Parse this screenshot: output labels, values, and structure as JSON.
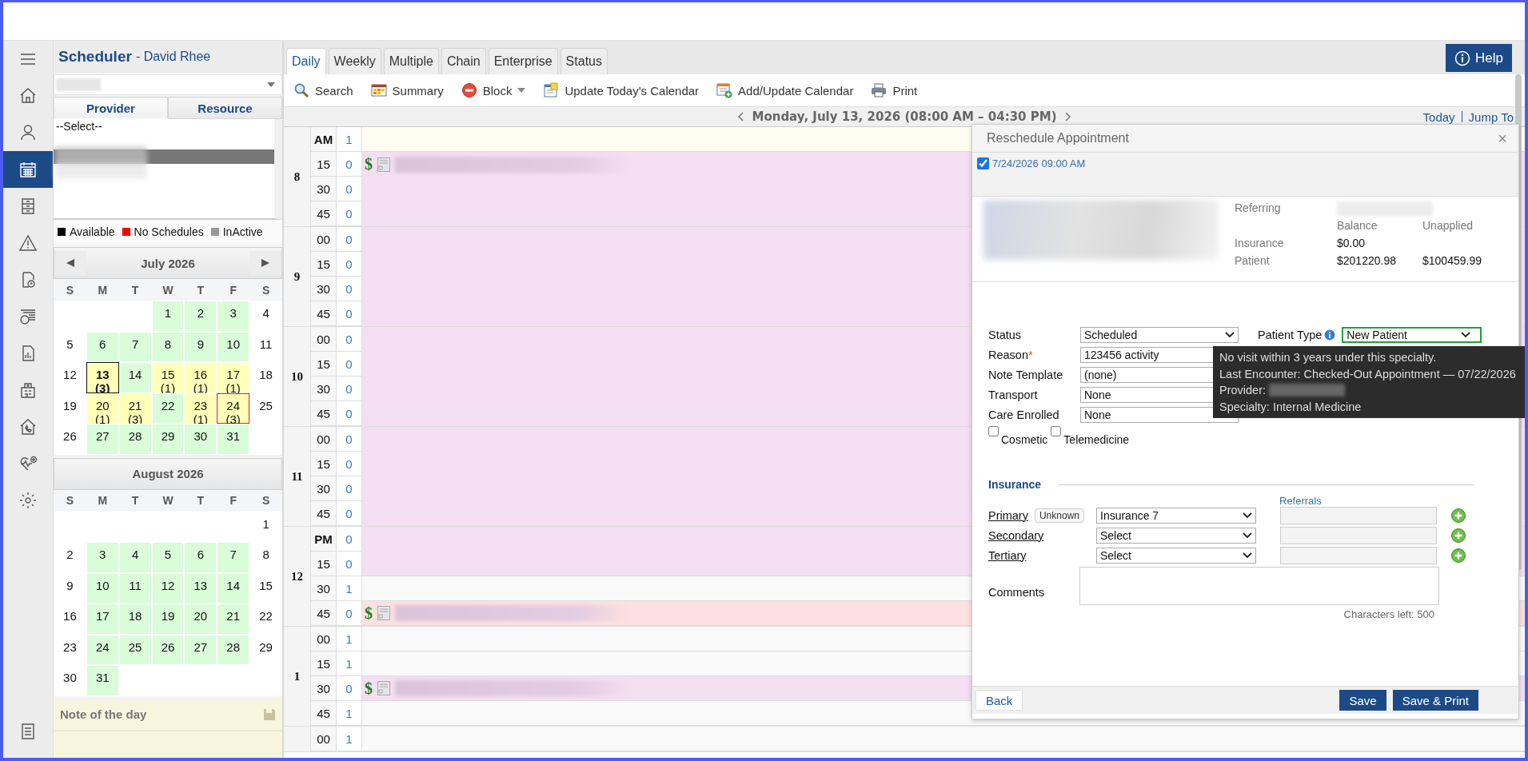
{
  "nav_rail": [
    {
      "selected": false
    },
    {
      "selected": false
    },
    {
      "selected": false
    },
    {
      "selected": true
    },
    {
      "selected": false
    },
    {
      "selected": false
    },
    {
      "selected": false
    },
    {
      "selected": false
    },
    {
      "selected": false
    },
    {
      "selected": false
    },
    {
      "selected": false
    },
    {
      "selected": false
    },
    {
      "selected": false
    }
  ],
  "nav_bottom": {
    "selected": false
  },
  "app_title": {
    "title": "Scheduler",
    "subtitle": "- David Rhee"
  },
  "selector_tabs": [
    {
      "label": "Provider",
      "selected": true
    },
    {
      "label": "Resource",
      "selected": false
    }
  ],
  "provider_list": [
    {
      "label": "--Select--",
      "selected": false
    },
    {
      "selected": true
    }
  ],
  "legend": [
    {
      "label": "Available",
      "color": "#000000"
    },
    {
      "label": "No Schedules",
      "color": "#ff0000"
    },
    {
      "label": "InActive",
      "color": "#999999"
    }
  ],
  "calendars": [
    {
      "title": "July 2026",
      "navigation": true,
      "weekdays": [
        "S",
        "M",
        "T",
        "W",
        "T",
        "F",
        "S"
      ],
      "days": [
        {
          "kind": "blank"
        },
        {
          "kind": "blank"
        },
        {
          "kind": "blank"
        },
        {
          "day": "1",
          "kind": "available",
          "today": false,
          "selected": false
        },
        {
          "day": "2",
          "kind": "available",
          "today": false,
          "selected": false
        },
        {
          "day": "3",
          "kind": "available",
          "today": false,
          "selected": false
        },
        {
          "day": "4",
          "kind": "open",
          "today": false,
          "selected": false
        },
        {
          "day": "5",
          "kind": "open",
          "today": false,
          "selected": false
        },
        {
          "day": "6",
          "kind": "available",
          "today": false,
          "selected": false
        },
        {
          "day": "7",
          "kind": "available",
          "today": false,
          "selected": false
        },
        {
          "day": "8",
          "kind": "available",
          "today": false,
          "selected": false
        },
        {
          "day": "9",
          "kind": "available",
          "today": false,
          "selected": false
        },
        {
          "day": "10",
          "kind": "available",
          "today": false,
          "selected": false
        },
        {
          "day": "11",
          "kind": "open",
          "today": false,
          "selected": false
        },
        {
          "day": "12",
          "kind": "open",
          "today": false,
          "selected": false
        },
        {
          "day": "13",
          "count": "(3)",
          "kind": "booked",
          "today": true,
          "selected": false
        },
        {
          "day": "14",
          "kind": "available",
          "today": false,
          "selected": false
        },
        {
          "day": "15",
          "count": "(1)",
          "kind": "booked",
          "today": false,
          "selected": false
        },
        {
          "day": "16",
          "count": "(1)",
          "kind": "booked",
          "today": false,
          "selected": false
        },
        {
          "day": "17",
          "count": "(1)",
          "kind": "booked",
          "today": false,
          "selected": false
        },
        {
          "day": "18",
          "kind": "open",
          "today": false,
          "selected": false
        },
        {
          "day": "19",
          "kind": "open",
          "today": false,
          "selected": false
        },
        {
          "day": "20",
          "count": "(1)",
          "kind": "booked",
          "today": false,
          "selected": false
        },
        {
          "day": "21",
          "count": "(3)",
          "kind": "booked",
          "today": false,
          "selected": false
        },
        {
          "day": "22",
          "kind": "available",
          "today": false,
          "selected": false
        },
        {
          "day": "23",
          "count": "(1)",
          "kind": "booked",
          "today": false,
          "selected": false
        },
        {
          "day": "24",
          "count": "(3)",
          "kind": "booked",
          "today": false,
          "selected": true
        },
        {
          "day": "25",
          "kind": "open",
          "today": false,
          "selected": false
        },
        {
          "day": "26",
          "kind": "open",
          "today": false,
          "selected": false
        },
        {
          "day": "27",
          "kind": "available",
          "today": false,
          "selected": false
        },
        {
          "day": "28",
          "kind": "available",
          "today": false,
          "selected": false
        },
        {
          "day": "29",
          "kind": "available",
          "today": false,
          "selected": false
        },
        {
          "day": "30",
          "kind": "available",
          "today": false,
          "selected": false
        },
        {
          "day": "31",
          "kind": "available",
          "today": false,
          "selected": false
        }
      ]
    },
    {
      "title": "August 2026",
      "navigation": false,
      "weekdays": [
        "S",
        "M",
        "T",
        "W",
        "T",
        "F",
        "S"
      ],
      "days": [
        {
          "kind": "blank"
        },
        {
          "kind": "blank"
        },
        {
          "kind": "blank"
        },
        {
          "kind": "blank"
        },
        {
          "kind": "blank"
        },
        {
          "kind": "blank"
        },
        {
          "day": "1",
          "kind": "open",
          "today": false,
          "selected": false
        },
        {
          "day": "2",
          "kind": "open",
          "today": false,
          "selected": false
        },
        {
          "day": "3",
          "kind": "available",
          "today": false,
          "selected": false
        },
        {
          "day": "4",
          "kind": "available",
          "today": false,
          "selected": false
        },
        {
          "day": "5",
          "kind": "available",
          "today": false,
          "selected": false
        },
        {
          "day": "6",
          "kind": "available",
          "today": false,
          "selected": false
        },
        {
          "day": "7",
          "kind": "available",
          "today": false,
          "selected": false
        },
        {
          "day": "8",
          "kind": "open",
          "today": false,
          "selected": false
        },
        {
          "day": "9",
          "kind": "open",
          "today": false,
          "selected": false
        },
        {
          "day": "10",
          "kind": "available",
          "today": false,
          "selected": false
        },
        {
          "day": "11",
          "kind": "available",
          "today": false,
          "selected": false
        },
        {
          "day": "12",
          "kind": "available",
          "today": false,
          "selected": false
        },
        {
          "day": "13",
          "kind": "available",
          "today": false,
          "selected": false
        },
        {
          "day": "14",
          "kind": "available",
          "today": false,
          "selected": false
        },
        {
          "day": "15",
          "kind": "open",
          "today": false,
          "selected": false
        },
        {
          "day": "16",
          "kind": "open",
          "today": false,
          "selected": false
        },
        {
          "day": "17",
          "kind": "available",
          "today": false,
          "selected": false
        },
        {
          "day": "18",
          "kind": "available",
          "today": false,
          "selected": false
        },
        {
          "day": "19",
          "kind": "available",
          "today": false,
          "selected": false
        },
        {
          "day": "20",
          "kind": "available",
          "today": false,
          "selected": false
        },
        {
          "day": "21",
          "kind": "available",
          "today": false,
          "selected": false
        },
        {
          "day": "22",
          "kind": "open",
          "today": false,
          "selected": false
        },
        {
          "day": "23",
          "kind": "open",
          "today": false,
          "selected": false
        },
        {
          "day": "24",
          "kind": "available",
          "today": false,
          "selected": false
        },
        {
          "day": "25",
          "kind": "available",
          "today": false,
          "selected": false
        },
        {
          "day": "26",
          "kind": "available",
          "today": false,
          "selected": false
        },
        {
          "day": "27",
          "kind": "available",
          "today": false,
          "selected": false
        },
        {
          "day": "28",
          "kind": "available",
          "today": false,
          "selected": false
        },
        {
          "day": "29",
          "kind": "open",
          "today": false,
          "selected": false
        },
        {
          "day": "30",
          "kind": "open",
          "today": false,
          "selected": false
        },
        {
          "day": "31",
          "kind": "available",
          "today": false,
          "selected": false
        }
      ]
    }
  ],
  "note_of_the_day": {
    "title": "Note of the day"
  },
  "view_tabs": [
    {
      "label": "Daily",
      "selected": true
    },
    {
      "label": "Weekly",
      "selected": false
    },
    {
      "label": "Multiple",
      "selected": false
    },
    {
      "label": "Chain",
      "selected": false
    },
    {
      "label": "Enterprise",
      "selected": false
    },
    {
      "label": "Status",
      "selected": false
    }
  ],
  "toolbar": [
    {
      "label": "Search",
      "dropdown": false
    },
    {
      "label": "Summary",
      "dropdown": false
    },
    {
      "label": "Block",
      "dropdown": true
    },
    {
      "label": "Update Today's Calendar",
      "dropdown": false
    },
    {
      "label": "Add/Update Calendar",
      "dropdown": false
    },
    {
      "label": "Print",
      "dropdown": false
    }
  ],
  "date_bar": {
    "date": "Monday, July 13, 2026 (08:00 AM – 04:30 PM)",
    "links": [
      "Today",
      "Jump To"
    ]
  },
  "help": {
    "label": "Help"
  },
  "schedule": [
    {
      "label": "8",
      "slots": [
        {
          "minute": "AM",
          "meridiem": true,
          "count": "1",
          "kind": "first"
        },
        {
          "minute": "15",
          "meridiem": false,
          "count": "0",
          "kind": "booked",
          "appointment": {
            "mark": "$"
          }
        },
        {
          "minute": "30",
          "meridiem": false,
          "count": "0",
          "kind": "booked"
        },
        {
          "minute": "45",
          "meridiem": false,
          "count": "0",
          "kind": "booked"
        }
      ]
    },
    {
      "label": "9",
      "slots": [
        {
          "minute": "00",
          "meridiem": false,
          "count": "0",
          "kind": "booked"
        },
        {
          "minute": "15",
          "meridiem": false,
          "count": "0",
          "kind": "booked"
        },
        {
          "minute": "30",
          "meridiem": false,
          "count": "0",
          "kind": "booked"
        },
        {
          "minute": "45",
          "meridiem": false,
          "count": "0",
          "kind": "booked"
        }
      ]
    },
    {
      "label": "10",
      "slots": [
        {
          "minute": "00",
          "meridiem": false,
          "count": "0",
          "kind": "booked"
        },
        {
          "minute": "15",
          "meridiem": false,
          "count": "0",
          "kind": "booked"
        },
        {
          "minute": "30",
          "meridiem": false,
          "count": "0",
          "kind": "booked"
        },
        {
          "minute": "45",
          "meridiem": false,
          "count": "0",
          "kind": "booked"
        }
      ]
    },
    {
      "label": "11",
      "slots": [
        {
          "minute": "00",
          "meridiem": false,
          "count": "0",
          "kind": "booked"
        },
        {
          "minute": "15",
          "meridiem": false,
          "count": "0",
          "kind": "booked"
        },
        {
          "minute": "30",
          "meridiem": false,
          "count": "0",
          "kind": "booked"
        },
        {
          "minute": "45",
          "meridiem": false,
          "count": "0",
          "kind": "booked"
        }
      ]
    },
    {
      "label": "12",
      "slots": [
        {
          "minute": "PM",
          "meridiem": true,
          "count": "0",
          "kind": "booked"
        },
        {
          "minute": "15",
          "meridiem": false,
          "count": "0",
          "kind": "booked"
        },
        {
          "minute": "30",
          "meridiem": false,
          "count": "1",
          "kind": "open"
        },
        {
          "minute": "45",
          "meridiem": false,
          "count": "0",
          "kind": "flagged",
          "appointment": {
            "mark": "$"
          }
        }
      ]
    },
    {
      "label": "1",
      "slots": [
        {
          "minute": "00",
          "meridiem": false,
          "count": "1",
          "kind": "open"
        },
        {
          "minute": "15",
          "meridiem": false,
          "count": "1",
          "kind": "open"
        },
        {
          "minute": "30",
          "meridiem": false,
          "count": "0",
          "kind": "booked",
          "appointment": {
            "mark": "$"
          }
        },
        {
          "minute": "45",
          "meridiem": false,
          "count": "1",
          "kind": "open"
        }
      ]
    },
    {
      "slots": [
        {
          "minute": "00",
          "meridiem": false,
          "count": "1",
          "kind": "open"
        }
      ]
    }
  ],
  "dialog": {
    "title": "Reschedule Appointment",
    "close": "×",
    "option": {
      "label": "7/24/2026 09:00 AM",
      "checked": true
    },
    "referring": "Referring",
    "balance_headers": [
      "Balance",
      "Unapplied"
    ],
    "balances": [
      {
        "label": "Insurance",
        "balance": "$0.00"
      },
      {
        "label": "Patient",
        "balance": "$201220.98",
        "unapplied": "$100459.99"
      }
    ],
    "required_mark": "*",
    "fields": [
      {
        "label": "Status",
        "value": "Scheduled",
        "required": false,
        "dropdown": true
      },
      {
        "label": "Reason",
        "value": "123456 activity",
        "required": true
      },
      {
        "label": "Note Template",
        "value": "(none)",
        "required": false
      },
      {
        "label": "Transport",
        "value": "None",
        "required": false
      },
      {
        "label": "Care Enrolled",
        "value": "None",
        "required": false
      }
    ],
    "patient_type": {
      "label": "Patient Type",
      "value": "New Patient"
    },
    "options": [
      {
        "label": "Cosmetic",
        "checked": false
      },
      {
        "label": "Telemedicine",
        "checked": false
      }
    ],
    "insurance": {
      "title": "Insurance",
      "referrals": "Referrals",
      "rows": [
        {
          "label": "Primary",
          "badge": "Unknown",
          "value": "Insurance 7"
        },
        {
          "label": "Secondary",
          "value": "Select"
        },
        {
          "label": "Tertiary",
          "value": "Select"
        }
      ],
      "comments_label": "Comments",
      "characters_left": "Characters left: 500"
    },
    "buttons": [
      {
        "label": "Back",
        "kind": "secondary"
      },
      {
        "label": "Save",
        "kind": "primary"
      },
      {
        "label": "Save & Print",
        "kind": "primary"
      }
    ]
  },
  "tooltip": {
    "lines": [
      {
        "text": "No visit within 3 years under this specialty.",
        "redacted": false
      },
      {
        "text": "Last Encounter: Checked-Out Appointment — 07/22/2026",
        "redacted": false
      },
      {
        "text": "Provider:",
        "redacted": true
      },
      {
        "text": "Specialty: Internal Medicine",
        "redacted": false
      }
    ]
  }
}
